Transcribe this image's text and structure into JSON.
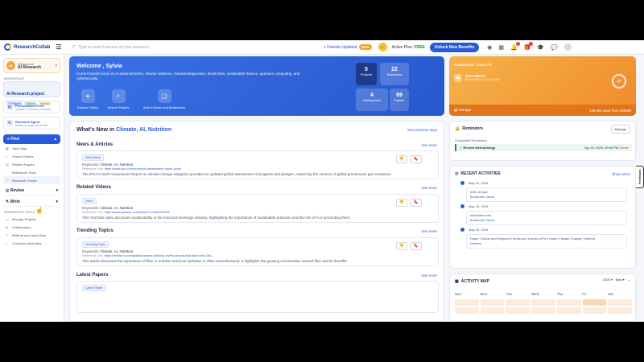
{
  "topbar": {
    "brand": "ResearchCollab",
    "search_placeholder": "Type to search across all your research...",
    "friends_label": "+ Friends Updated",
    "friends_badge": "NEW",
    "plan_label": "Active Plan:",
    "plan_value": "FREE",
    "unlock_label": "Unlock New Benefits",
    "notif_count": "2"
  },
  "sidebar": {
    "workspace_caption": "Workspace",
    "workspace_name": "AI Research",
    "workspace_initials": "AI",
    "workspace_section": "WORKSPACE",
    "project_name": "AI Research project",
    "tags": [
      "10 Papers",
      "8 Notes",
      "Search"
    ],
    "feed_title": "Personalized Feed",
    "feed_sub": "Updates & trending research",
    "agent_title": "Research Agent",
    "agent_sub": "Ready to paper generation",
    "find_label": "Find",
    "find_items": [
      "Topic Map",
      "Search Papers",
      "Related Papers",
      "Brainstorm Topic",
      "Research Trends"
    ],
    "review_label": "Review",
    "write_label": "Write",
    "tools_caption": "WORKSPACE TOOLS",
    "tools": [
      "Manage Projects",
      "Collaboration",
      "Refferal and share Beta",
      "Collective Mind Beta"
    ]
  },
  "welcome": {
    "title": "Welcome , Sylvia",
    "desc": "Current trends focus on AI advancements, climate solutions, medical diagnostics, blockchain, sustainable finance, quantum computing, and cybersecurity.",
    "actions": [
      "Explore Topics",
      "Search Papers",
      "Add to Notes and Bookmarks"
    ],
    "stats": [
      {
        "value": "5",
        "label": "Projects"
      },
      {
        "value": "22",
        "label": "Resources"
      },
      {
        "value": "4",
        "label": "Workspaces"
      },
      {
        "value": "69",
        "label": "Papers"
      }
    ]
  },
  "whatsnew": {
    "heading_prefix": "What's New in ",
    "heading_topic": "Climate, AI, Nutrition",
    "see_previous": "See previous days",
    "see_more": "See more",
    "sections": [
      {
        "title": "News & Articles",
        "chip": "Web Article",
        "keywords_label": "Keywords:",
        "keywords": "Climate, AI, Nutrition",
        "ref_label": "Reference Link:",
        "ref": "https://www.ipcc.ch/report/sixth-assessment-report-cycle/",
        "desc": "The IPCC's Sixth Assessment Report on climate change mitigation provides an updated global assessment of progress and pledges, examining the sources of global greenhouse gas emissions."
      },
      {
        "title": "Related Videos",
        "chip": "Video",
        "keywords_label": "Keywords:",
        "keywords": "Climate, AI, Nutrition",
        "ref_label": "Reference Link:",
        "ref": "https://www.youtube.com/watch?v=xxBe5FeeRs",
        "desc": "This YouTube video discusses sustainability in the food and beverage industry, highlighting the importance of sustainable practices and the role of AI in promoting them."
      },
      {
        "title": "Trending Topics",
        "chip": "Trending Topic",
        "keywords_label": "Keywords:",
        "keywords": "Climate, AI, Nutrition",
        "ref_label": "Reference Link:",
        "ref": "https://medium.com/hydration/water-drinking-myths-around-hydration-exist-16d...",
        "desc": "This article discusses the importance of fiber in nutrition and how hydration is often misunderstood. It highlights the growing conversation around fiber and its benefits."
      }
    ],
    "latest_title": "Latest Papers",
    "latest_chip": "Latest Paper"
  },
  "credits": {
    "caption": "REMAINING CREDITS",
    "name": "ENDOBEST",
    "sub": "Next Refill on 27-01-2025",
    "storage_label": "Storage",
    "storage_value": "145 MB used from 300MB"
  },
  "reminders": {
    "title": "Reminders",
    "manage": "Manage",
    "completed_caption": "Completed Reminders",
    "item": "Review Methodology",
    "item_date": "Apr 29, 2025, 09:00 PM",
    "delete_label": "Delete"
  },
  "activities": {
    "title": "RECENT ACTIVITIES",
    "show_more": "Show More",
    "entries": [
      {
        "date": "May 15, 2025",
        "line1": "hello-hh.gov",
        "line2": "Bookmark Saved"
      },
      {
        "date": "May 15, 2025",
        "line1": "searchbar.com",
        "line2": "Bookmark Saved"
      },
      {
        "date": "May 15, 2025",
        "line1": "Paper \"Global and Regional Trends and Drivers of Fire Under Climate Change\" Deleted",
        "line2": "Deleted"
      }
    ]
  },
  "activity_map": {
    "title": "ACTIVITY MAP",
    "year": "2025",
    "month": "May",
    "days": [
      "Sun",
      "Mon",
      "Tue",
      "Wed",
      "Thu",
      "Fri",
      "Sat"
    ]
  },
  "feedback_label": "Feedback"
}
